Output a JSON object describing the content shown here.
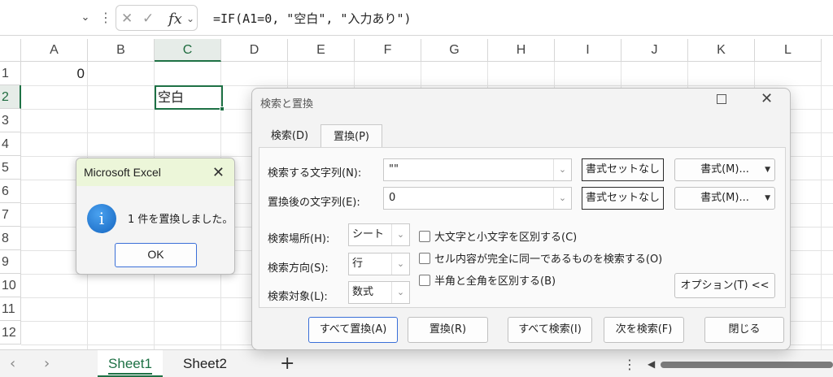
{
  "formula_bar": {
    "formula": "=IF(A1=0, \"空白\", \"入力あり\")",
    "fx_label": "fx",
    "cancel_glyph": "✕",
    "enter_glyph": "✓"
  },
  "grid": {
    "columns": [
      "A",
      "B",
      "C",
      "D",
      "E",
      "F",
      "G",
      "H",
      "I",
      "J",
      "K",
      "L"
    ],
    "rows": [
      "1",
      "2",
      "3",
      "4",
      "5",
      "6",
      "7",
      "8",
      "9",
      "10",
      "11",
      "12"
    ],
    "selected_column": "C",
    "selected_row": "2",
    "cells": {
      "A1": "0",
      "C2": "空白"
    }
  },
  "sheet_tabs": {
    "tabs": [
      "Sheet1",
      "Sheet2"
    ],
    "active": "Sheet1",
    "add_label": "+"
  },
  "message_box": {
    "title": "Microsoft Excel",
    "message": "1 件を置換しました。",
    "ok_label": "OK",
    "icon": "info-icon",
    "title_bg": "#ecf6d9"
  },
  "find_replace": {
    "title": "検索と置換",
    "tabs": [
      "検索(D)",
      "置換(P)"
    ],
    "active_tab": "置換(P)",
    "find_label": "検索する文字列(N):",
    "find_value": "\"\"",
    "replace_label": "置換後の文字列(E):",
    "replace_value": "0",
    "no_format_label_1": "書式セットなし",
    "no_format_label_2": "書式セットなし",
    "format_label_1": "書式(M)...",
    "format_label_2": "書式(M)...",
    "within_label": "検索場所(H):",
    "within_value": "シート",
    "search_label": "検索方向(S):",
    "search_value": "行",
    "lookin_label": "検索対象(L):",
    "lookin_value": "数式",
    "match_case_label": "大文字と小文字を区別する(C)",
    "match_entire_label": "セル内容が完全に同一であるものを検索する(O)",
    "match_byte_label": "半角と全角を区別する(B)",
    "options_label": "オプション(T) <<",
    "replace_all_label": "すべて置換(A)",
    "replace_label_btn": "置換(R)",
    "find_all_label": "すべて検索(I)",
    "find_next_label": "次を検索(F)",
    "close_label": "閉じる"
  },
  "colors": {
    "excel_green": "#1e7145",
    "primary_blue": "#3a6fd8"
  }
}
